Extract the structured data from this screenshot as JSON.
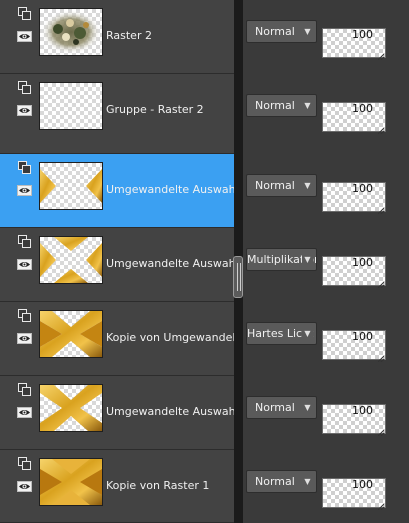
{
  "layers": [
    {
      "name": "Raster 2",
      "blend_mode": "Normal",
      "opacity": "100",
      "selected": false,
      "thumb": "image"
    },
    {
      "name": "Gruppe - Raster 2",
      "blend_mode": "Normal",
      "opacity": "100",
      "selected": false,
      "thumb": "empty"
    },
    {
      "name": "Umgewandelte Auswahl",
      "blend_mode": "Normal",
      "opacity": "100",
      "selected": true,
      "thumb": "side-triangles"
    },
    {
      "name": "Umgewandelte Auswahl",
      "blend_mode": "Multiplikation",
      "opacity": "100",
      "selected": false,
      "thumb": "x-light"
    },
    {
      "name": "Kopie von Umgewandelte Auswahl",
      "blend_mode": "Hartes Licht",
      "opacity": "100",
      "selected": false,
      "thumb": "x-dark"
    },
    {
      "name": "Umgewandelte Auswahl",
      "blend_mode": "Normal",
      "opacity": "100",
      "selected": false,
      "thumb": "x-gold"
    },
    {
      "name": "Kopie von Raster 1",
      "blend_mode": "Normal",
      "opacity": "100",
      "selected": false,
      "thumb": "full-gold"
    }
  ],
  "icons": {
    "link": "layer-link-icon",
    "visibility": "eye-icon",
    "dropdown": "chevron-down-icon"
  },
  "colors": {
    "selected_row": "#3ba0f2",
    "row_bg": "#434343",
    "panel_bg": "#3a3a3a",
    "gold": "#d9a21f",
    "dark_gold": "#8a5a0c"
  }
}
